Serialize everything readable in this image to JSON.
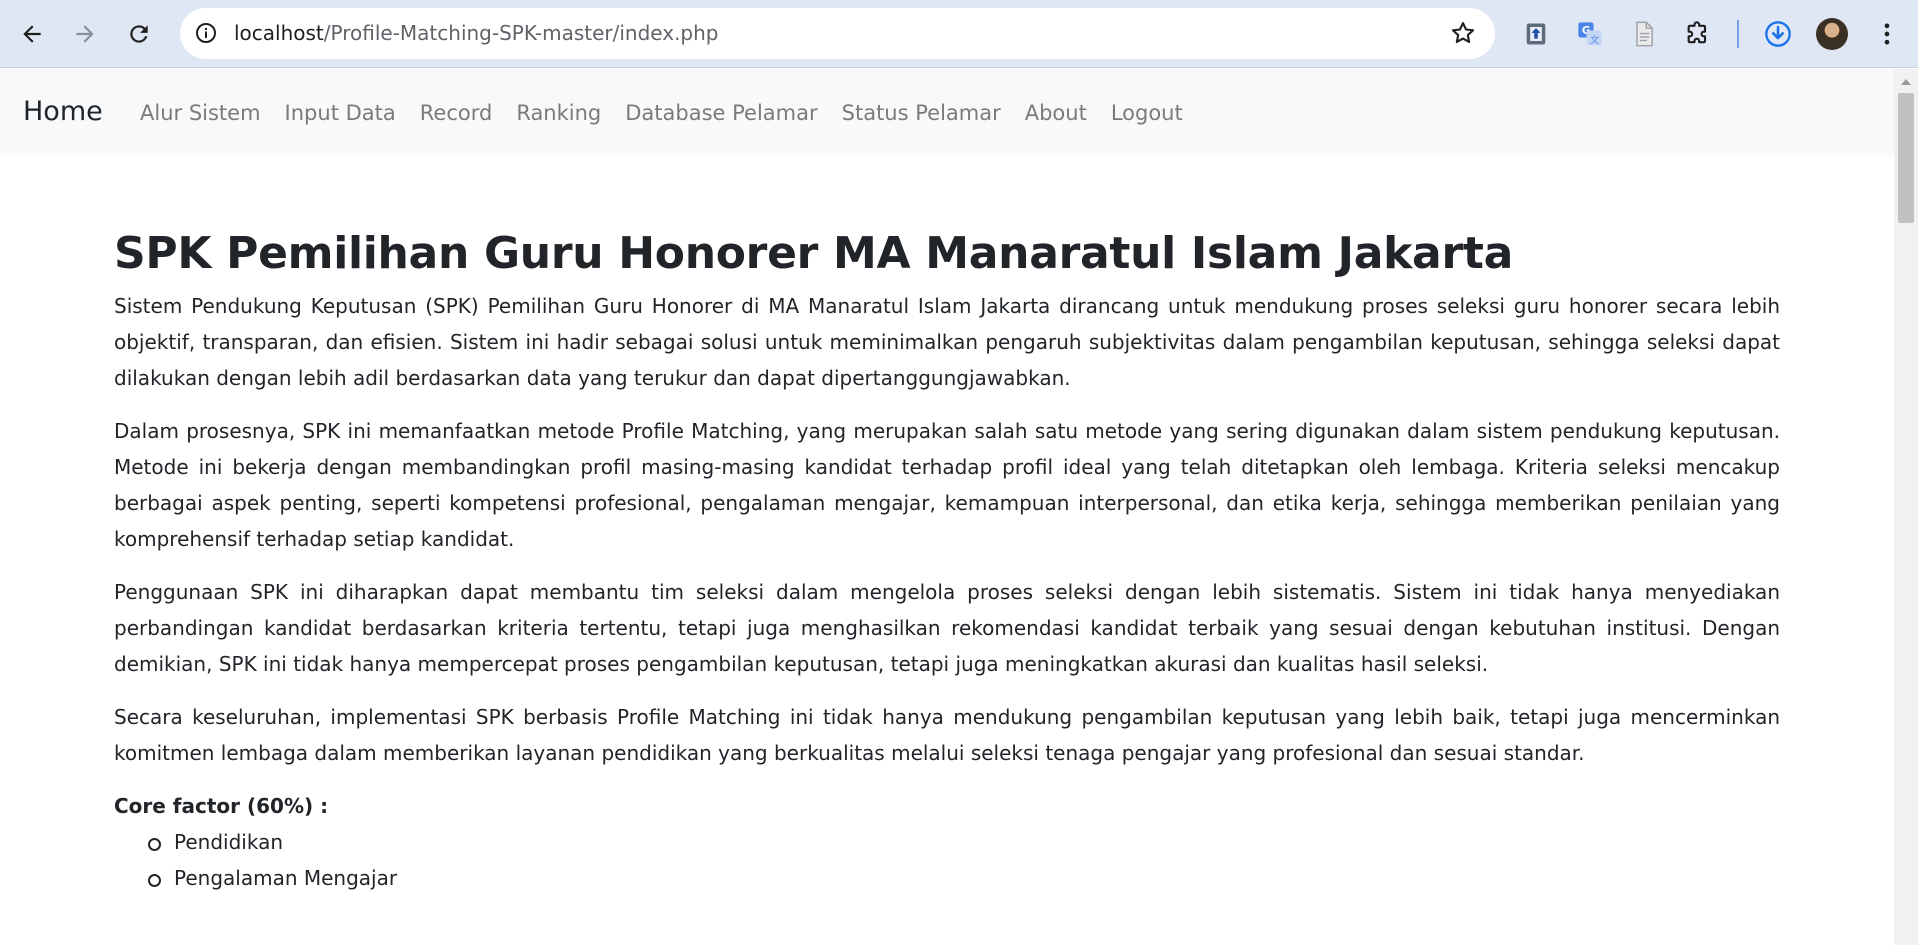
{
  "browser": {
    "url_host": "localhost",
    "url_path": "/Profile-Matching-SPK-master/index.php",
    "icons": [
      "back-arrow-icon",
      "forward-arrow-icon",
      "reload-icon",
      "site-info-icon",
      "bookmark-star-icon",
      "extension-upload-icon",
      "google-translate-icon",
      "document-icon",
      "puzzle-extensions-icon",
      "download-icon",
      "profile-avatar",
      "kebab-menu-icon"
    ]
  },
  "navbar": {
    "brand": "Home",
    "links": [
      "Alur Sistem",
      "Input Data",
      "Record",
      "Ranking",
      "Database Pelamar",
      "Status Pelamar",
      "About",
      "Logout"
    ]
  },
  "main": {
    "title": "SPK Pemilihan Guru Honorer MA Manaratul Islam Jakarta",
    "paragraphs": [
      "Sistem Pendukung Keputusan (SPK) Pemilihan Guru Honorer di MA Manaratul Islam Jakarta dirancang untuk mendukung proses seleksi guru honorer secara lebih objektif, transparan, dan efisien. Sistem ini hadir sebagai solusi untuk meminimalkan pengaruh subjektivitas dalam pengambilan keputusan, sehingga seleksi dapat dilakukan dengan lebih adil berdasarkan data yang terukur dan dapat dipertanggungjawabkan.",
      "Dalam prosesnya, SPK ini memanfaatkan metode Profile Matching, yang merupakan salah satu metode yang sering digunakan dalam sistem pendukung keputusan. Metode ini bekerja dengan membandingkan profil masing-masing kandidat terhadap profil ideal yang telah ditetapkan oleh lembaga. Kriteria seleksi mencakup berbagai aspek penting, seperti kompetensi profesional, pengalaman mengajar, kemampuan interpersonal, dan etika kerja, sehingga memberikan penilaian yang komprehensif terhadap setiap kandidat.",
      "Penggunaan SPK ini diharapkan dapat membantu tim seleksi dalam mengelola proses seleksi dengan lebih sistematis. Sistem ini tidak hanya menyediakan perbandingan kandidat berdasarkan kriteria tertentu, tetapi juga menghasilkan rekomendasi kandidat terbaik yang sesuai dengan kebutuhan institusi. Dengan demikian, SPK ini tidak hanya mempercepat proses pengambilan keputusan, tetapi juga meningkatkan akurasi dan kualitas hasil seleksi.",
      "Secara keseluruhan, implementasi SPK berbasis Profile Matching ini tidak hanya mendukung pengambilan keputusan yang lebih baik, tetapi juga mencerminkan komitmen lembaga dalam memberikan layanan pendidikan yang berkualitas melalui seleksi tenaga pengajar yang profesional dan sesuai standar."
    ],
    "core_factor_title": "Core factor (60%) :",
    "core_factor_items": [
      "Pendidikan",
      "Pengalaman Mengajar"
    ]
  },
  "colors": {
    "chrome_bg": "#dfe7f5",
    "navbar_bg": "#f8f9fa",
    "link_gray": "#7a7a7a",
    "download_blue": "#1a73e8"
  }
}
